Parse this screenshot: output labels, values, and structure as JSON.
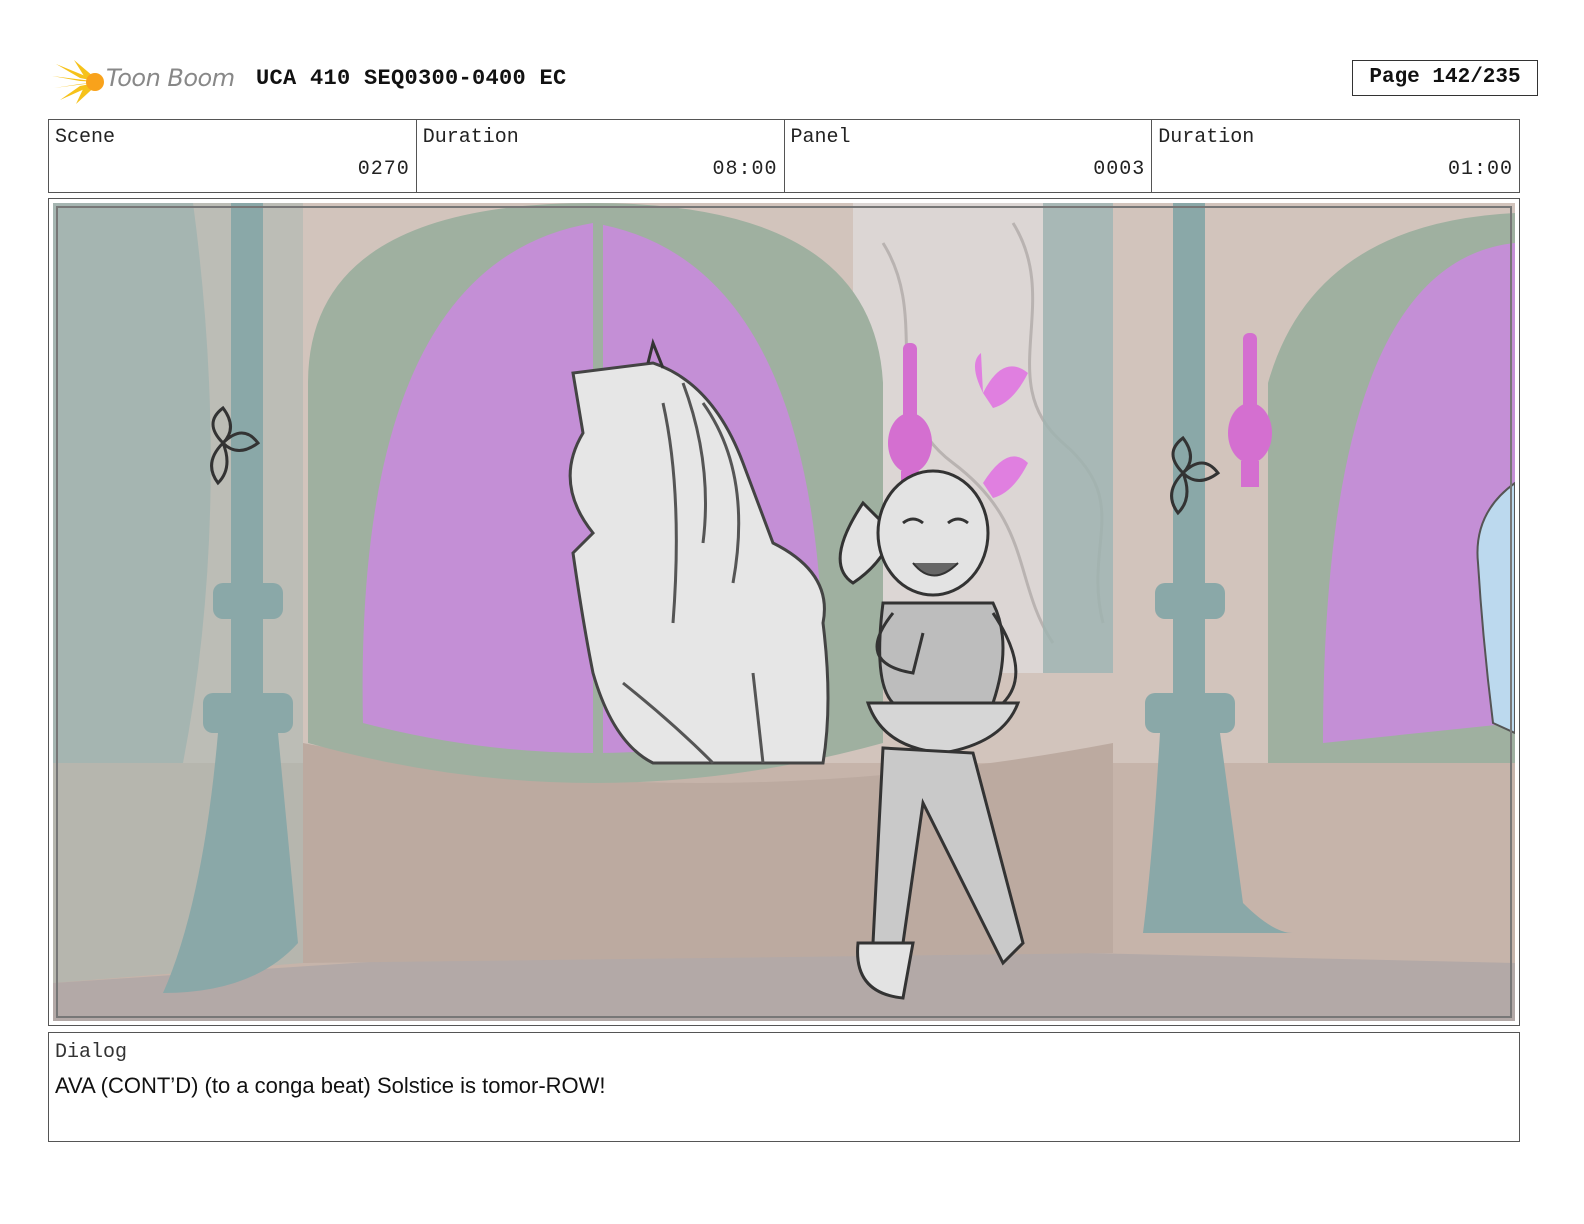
{
  "header": {
    "brand": "Toon Boom",
    "title": "UCA 410 SEQ0300-0400 EC",
    "page": "Page 142/235"
  },
  "info": {
    "scene_label": "Scene",
    "scene_value": "0270",
    "scene_duration_label": "Duration",
    "scene_duration_value": "08:00",
    "panel_label": "Panel",
    "panel_value": "0003",
    "panel_duration_label": "Duration",
    "panel_duration_value": "01:00"
  },
  "dialog": {
    "label": "Dialog",
    "text": "AVA (CONT’D) (to a conga beat) Solstice is tomor-ROW!"
  },
  "colors": {
    "window_purple": "#c48fd6",
    "arch_green": "#9fb0a0",
    "wall_tan": "#c1aea3",
    "pillar_teal": "#8aa8a8",
    "floor_grey": "#b4aaa8",
    "logo_yellow": "#f6c21a"
  }
}
